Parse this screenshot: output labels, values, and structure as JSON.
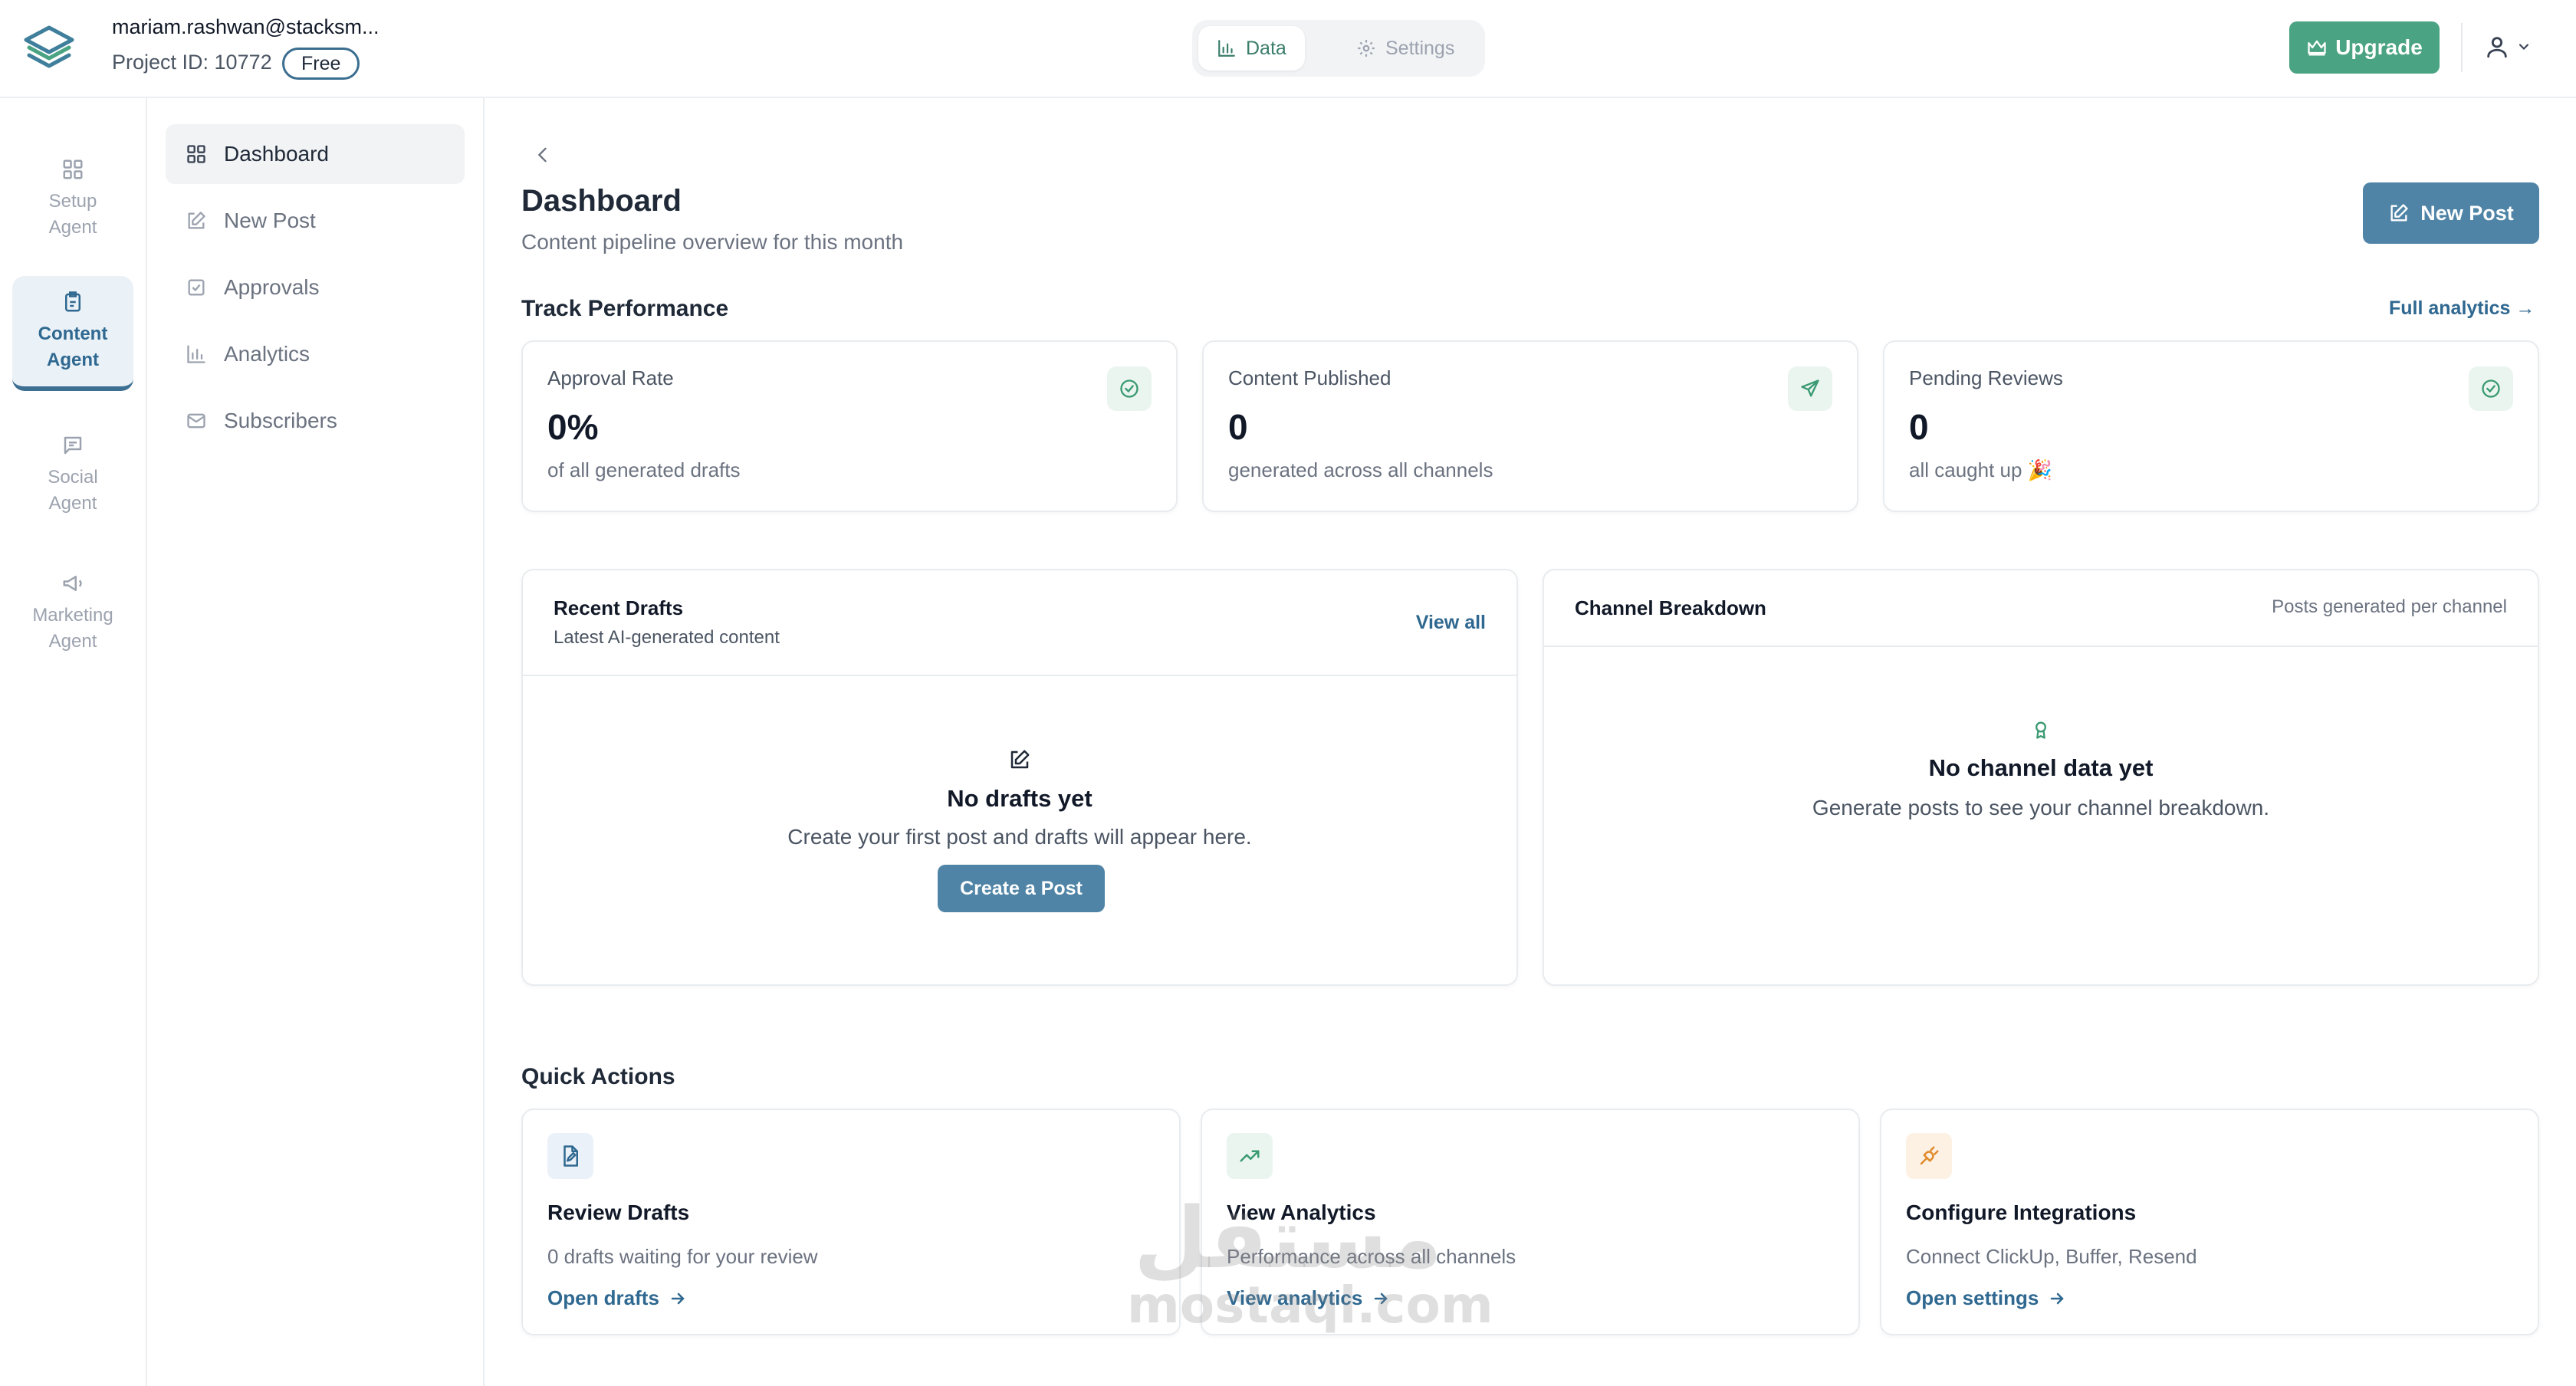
{
  "account": {
    "email": "mariam.rashwan@stacksm...",
    "project": "Project ID: 10772",
    "plan": "Free"
  },
  "top_tabs": {
    "data": "Data",
    "settings": "Settings"
  },
  "upgrade_label": "Upgrade",
  "agents": [
    {
      "line1": "Setup",
      "line2": "Agent",
      "icon": "grid-icon",
      "active": false
    },
    {
      "line1": "Content",
      "line2": "Agent",
      "icon": "clipboard-icon",
      "active": true
    },
    {
      "line1": "Social",
      "line2": "Agent",
      "icon": "chat-icon",
      "active": false
    },
    {
      "line1": "Marketing",
      "line2": "Agent",
      "icon": "megaphone-icon",
      "active": false
    }
  ],
  "nav": [
    {
      "label": "Dashboard",
      "icon": "grid-icon",
      "active": true
    },
    {
      "label": "New Post",
      "icon": "edit-icon",
      "active": false
    },
    {
      "label": "Approvals",
      "icon": "check-square-icon",
      "active": false
    },
    {
      "label": "Analytics",
      "icon": "bar-chart-icon",
      "active": false
    },
    {
      "label": "Subscribers",
      "icon": "mail-icon",
      "active": false
    }
  ],
  "page": {
    "title": "Dashboard",
    "subtitle": "Content pipeline overview for this month",
    "new_post": "New Post"
  },
  "performance": {
    "title": "Track Performance",
    "link": "Full analytics →",
    "cards": [
      {
        "label": "Approval Rate",
        "value": "0%",
        "sub": "of all generated drafts",
        "icon": "check-circle-icon"
      },
      {
        "label": "Content Published",
        "value": "0",
        "sub": "generated across all channels",
        "icon": "send-icon"
      },
      {
        "label": "Pending Reviews",
        "value": "0",
        "sub": "all caught up 🎉",
        "icon": "check-circle-icon"
      }
    ]
  },
  "recent_drafts": {
    "title": "Recent Drafts",
    "subtitle": "Latest AI-generated content",
    "link": "View all",
    "empty_title": "No drafts yet",
    "empty_sub": "Create your first post and drafts will appear here.",
    "cta": "Create a Post"
  },
  "channel_breakdown": {
    "title": "Channel Breakdown",
    "note": "Posts generated per channel",
    "empty_title": "No channel data yet",
    "empty_sub": "Generate posts to see your channel breakdown."
  },
  "quick_actions": {
    "title": "Quick Actions",
    "items": [
      {
        "title": "Review Drafts",
        "sub": "0 drafts waiting for your review",
        "link": "Open drafts",
        "icon": "file-edit-icon",
        "tint": "#eaf1f8"
      },
      {
        "title": "View Analytics",
        "sub": "Performance across all channels",
        "link": "View analytics",
        "icon": "trending-up-icon",
        "tint": "#eaf5ef"
      },
      {
        "title": "Configure Integrations",
        "sub": "Connect ClickUp, Buffer, Resend",
        "link": "Open settings",
        "icon": "plug-icon",
        "tint": "#fdf1e3"
      }
    ]
  },
  "watermark": {
    "arabic": "مستقل",
    "latin": "mostaql.com"
  }
}
